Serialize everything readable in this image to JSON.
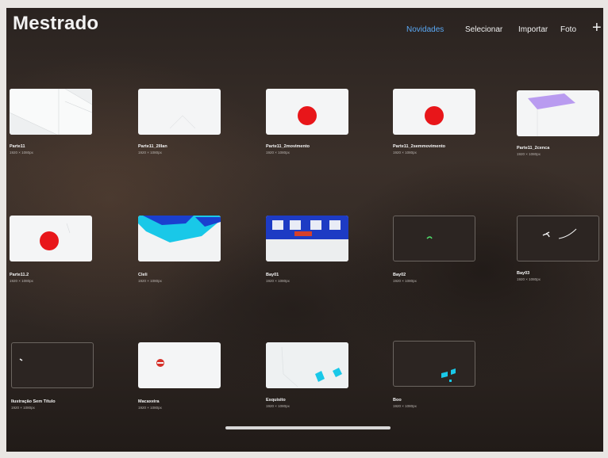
{
  "app": {
    "title": "Mestrado"
  },
  "nav": {
    "novidades": "Novidades",
    "selecionar": "Selecionar",
    "importar": "Importar",
    "foto": "Foto",
    "add": "+"
  },
  "artworks": [
    {
      "name": "Parte11",
      "size": "1920 × 1080px"
    },
    {
      "name": "Parte11_2Illan",
      "size": "1920 × 1080px"
    },
    {
      "name": "Parte11_2movimento",
      "size": "1920 × 1080px"
    },
    {
      "name": "Parte11_2semmovimento",
      "size": "1920 × 1080px"
    },
    {
      "name": "Parte11_2cenca",
      "size": "1920 × 1080px"
    },
    {
      "name": "Parte11.2",
      "size": "1920 × 1080px"
    },
    {
      "name": "Cleli",
      "size": "1920 × 1080px"
    },
    {
      "name": "Bay01",
      "size": "1920 × 1080px"
    },
    {
      "name": "Bay02",
      "size": "1920 × 1080px"
    },
    {
      "name": "Bay03",
      "size": "1920 × 1080px"
    },
    {
      "name": "Ilustração Sem Título",
      "size": "1920 × 1080px"
    },
    {
      "name": "Macaxeira",
      "size": "1920 × 1080px"
    },
    {
      "name": "Esquisito",
      "size": "1920 × 1080px"
    },
    {
      "name": "Boo",
      "size": "1920 × 1080px"
    }
  ],
  "colors": {
    "accent": "#5aa8f5",
    "red_dot": "#e8161a",
    "cyan": "#18c6e6",
    "purple": "#b99bf0"
  }
}
